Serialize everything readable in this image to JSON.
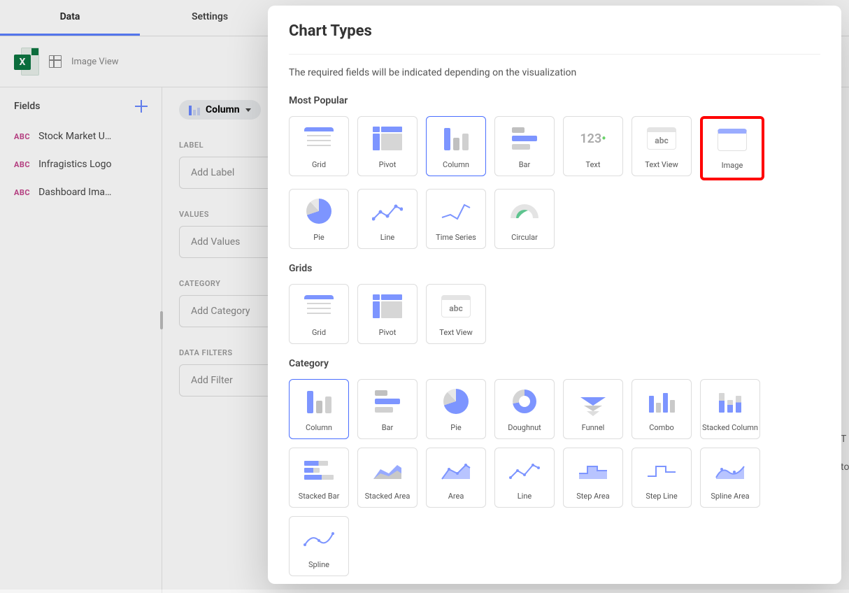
{
  "tabs": {
    "data": "Data",
    "settings": "Settings"
  },
  "source": {
    "icon_letter": "X",
    "name": "Image View"
  },
  "fields": {
    "title": "Fields",
    "items": [
      "Stock Market U…",
      "Infragistics Logo",
      "Dashboard Ima…"
    ]
  },
  "chart_selector_label": "Column",
  "config": {
    "label": {
      "title": "LABEL",
      "placeholder": "Add Label"
    },
    "values": {
      "title": "VALUES",
      "placeholder": "Add Values"
    },
    "category": {
      "title": "CATEGORY",
      "placeholder": "Add Category"
    },
    "filters": {
      "title": "DATA FILTERS",
      "placeholder": "Add Filter"
    }
  },
  "popup": {
    "title": "Chart Types",
    "description": "The required fields will be indicated depending on the visualization",
    "sections": {
      "most_popular": {
        "title": "Most Popular",
        "items": [
          "Grid",
          "Pivot",
          "Column",
          "Bar",
          "Text",
          "Text View",
          "Image",
          "Pie",
          "Line",
          "Time Series",
          "Circular"
        ]
      },
      "grids": {
        "title": "Grids",
        "items": [
          "Grid",
          "Pivot",
          "Text View"
        ]
      },
      "category": {
        "title": "Category",
        "items": [
          "Column",
          "Bar",
          "Pie",
          "Doughnut",
          "Funnel",
          "Combo",
          "Stacked Column",
          "Stacked Bar",
          "Stacked Area",
          "Area",
          "Line",
          "Step Area",
          "Step Line",
          "Spline Area",
          "Spline"
        ]
      }
    }
  },
  "selected_chart": "Column",
  "highlighted_chart": "Image",
  "peek": {
    "t": "T",
    "to": "to"
  }
}
